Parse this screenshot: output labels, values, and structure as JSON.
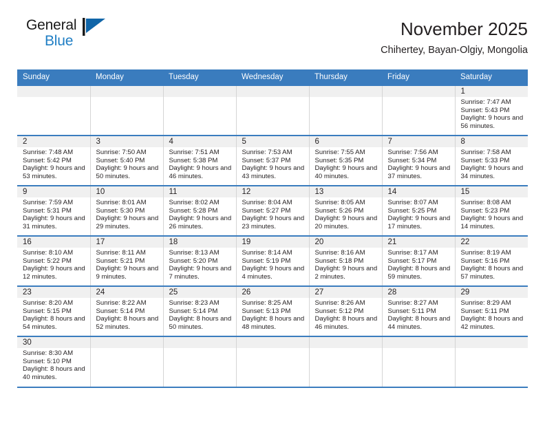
{
  "logo": {
    "name_part1": "General",
    "name_part2": "Blue",
    "flag_icon": "triangle-flag-icon",
    "accent_color": "#1f7ec4"
  },
  "header": {
    "month_title": "November 2025",
    "location": "Chihertey, Bayan-Olgiy, Mongolia"
  },
  "calendar": {
    "header_bg": "#3a7cbe",
    "daynum_bg": "#f0f0f0",
    "weekdays": [
      "Sunday",
      "Monday",
      "Tuesday",
      "Wednesday",
      "Thursday",
      "Friday",
      "Saturday"
    ],
    "weeks": [
      [
        {
          "empty": true
        },
        {
          "empty": true
        },
        {
          "empty": true
        },
        {
          "empty": true
        },
        {
          "empty": true
        },
        {
          "empty": true
        },
        {
          "day": "1",
          "sunrise": "Sunrise: 7:47 AM",
          "sunset": "Sunset: 5:43 PM",
          "daylight": "Daylight: 9 hours and 56 minutes."
        }
      ],
      [
        {
          "day": "2",
          "sunrise": "Sunrise: 7:48 AM",
          "sunset": "Sunset: 5:42 PM",
          "daylight": "Daylight: 9 hours and 53 minutes."
        },
        {
          "day": "3",
          "sunrise": "Sunrise: 7:50 AM",
          "sunset": "Sunset: 5:40 PM",
          "daylight": "Daylight: 9 hours and 50 minutes."
        },
        {
          "day": "4",
          "sunrise": "Sunrise: 7:51 AM",
          "sunset": "Sunset: 5:38 PM",
          "daylight": "Daylight: 9 hours and 46 minutes."
        },
        {
          "day": "5",
          "sunrise": "Sunrise: 7:53 AM",
          "sunset": "Sunset: 5:37 PM",
          "daylight": "Daylight: 9 hours and 43 minutes."
        },
        {
          "day": "6",
          "sunrise": "Sunrise: 7:55 AM",
          "sunset": "Sunset: 5:35 PM",
          "daylight": "Daylight: 9 hours and 40 minutes."
        },
        {
          "day": "7",
          "sunrise": "Sunrise: 7:56 AM",
          "sunset": "Sunset: 5:34 PM",
          "daylight": "Daylight: 9 hours and 37 minutes."
        },
        {
          "day": "8",
          "sunrise": "Sunrise: 7:58 AM",
          "sunset": "Sunset: 5:33 PM",
          "daylight": "Daylight: 9 hours and 34 minutes."
        }
      ],
      [
        {
          "day": "9",
          "sunrise": "Sunrise: 7:59 AM",
          "sunset": "Sunset: 5:31 PM",
          "daylight": "Daylight: 9 hours and 31 minutes."
        },
        {
          "day": "10",
          "sunrise": "Sunrise: 8:01 AM",
          "sunset": "Sunset: 5:30 PM",
          "daylight": "Daylight: 9 hours and 29 minutes."
        },
        {
          "day": "11",
          "sunrise": "Sunrise: 8:02 AM",
          "sunset": "Sunset: 5:28 PM",
          "daylight": "Daylight: 9 hours and 26 minutes."
        },
        {
          "day": "12",
          "sunrise": "Sunrise: 8:04 AM",
          "sunset": "Sunset: 5:27 PM",
          "daylight": "Daylight: 9 hours and 23 minutes."
        },
        {
          "day": "13",
          "sunrise": "Sunrise: 8:05 AM",
          "sunset": "Sunset: 5:26 PM",
          "daylight": "Daylight: 9 hours and 20 minutes."
        },
        {
          "day": "14",
          "sunrise": "Sunrise: 8:07 AM",
          "sunset": "Sunset: 5:25 PM",
          "daylight": "Daylight: 9 hours and 17 minutes."
        },
        {
          "day": "15",
          "sunrise": "Sunrise: 8:08 AM",
          "sunset": "Sunset: 5:23 PM",
          "daylight": "Daylight: 9 hours and 14 minutes."
        }
      ],
      [
        {
          "day": "16",
          "sunrise": "Sunrise: 8:10 AM",
          "sunset": "Sunset: 5:22 PM",
          "daylight": "Daylight: 9 hours and 12 minutes."
        },
        {
          "day": "17",
          "sunrise": "Sunrise: 8:11 AM",
          "sunset": "Sunset: 5:21 PM",
          "daylight": "Daylight: 9 hours and 9 minutes."
        },
        {
          "day": "18",
          "sunrise": "Sunrise: 8:13 AM",
          "sunset": "Sunset: 5:20 PM",
          "daylight": "Daylight: 9 hours and 7 minutes."
        },
        {
          "day": "19",
          "sunrise": "Sunrise: 8:14 AM",
          "sunset": "Sunset: 5:19 PM",
          "daylight": "Daylight: 9 hours and 4 minutes."
        },
        {
          "day": "20",
          "sunrise": "Sunrise: 8:16 AM",
          "sunset": "Sunset: 5:18 PM",
          "daylight": "Daylight: 9 hours and 2 minutes."
        },
        {
          "day": "21",
          "sunrise": "Sunrise: 8:17 AM",
          "sunset": "Sunset: 5:17 PM",
          "daylight": "Daylight: 8 hours and 59 minutes."
        },
        {
          "day": "22",
          "sunrise": "Sunrise: 8:19 AM",
          "sunset": "Sunset: 5:16 PM",
          "daylight": "Daylight: 8 hours and 57 minutes."
        }
      ],
      [
        {
          "day": "23",
          "sunrise": "Sunrise: 8:20 AM",
          "sunset": "Sunset: 5:15 PM",
          "daylight": "Daylight: 8 hours and 54 minutes."
        },
        {
          "day": "24",
          "sunrise": "Sunrise: 8:22 AM",
          "sunset": "Sunset: 5:14 PM",
          "daylight": "Daylight: 8 hours and 52 minutes."
        },
        {
          "day": "25",
          "sunrise": "Sunrise: 8:23 AM",
          "sunset": "Sunset: 5:14 PM",
          "daylight": "Daylight: 8 hours and 50 minutes."
        },
        {
          "day": "26",
          "sunrise": "Sunrise: 8:25 AM",
          "sunset": "Sunset: 5:13 PM",
          "daylight": "Daylight: 8 hours and 48 minutes."
        },
        {
          "day": "27",
          "sunrise": "Sunrise: 8:26 AM",
          "sunset": "Sunset: 5:12 PM",
          "daylight": "Daylight: 8 hours and 46 minutes."
        },
        {
          "day": "28",
          "sunrise": "Sunrise: 8:27 AM",
          "sunset": "Sunset: 5:11 PM",
          "daylight": "Daylight: 8 hours and 44 minutes."
        },
        {
          "day": "29",
          "sunrise": "Sunrise: 8:29 AM",
          "sunset": "Sunset: 5:11 PM",
          "daylight": "Daylight: 8 hours and 42 minutes."
        }
      ],
      [
        {
          "day": "30",
          "sunrise": "Sunrise: 8:30 AM",
          "sunset": "Sunset: 5:10 PM",
          "daylight": "Daylight: 8 hours and 40 minutes."
        },
        {
          "empty": true
        },
        {
          "empty": true
        },
        {
          "empty": true
        },
        {
          "empty": true
        },
        {
          "empty": true
        },
        {
          "empty": true
        }
      ]
    ]
  }
}
